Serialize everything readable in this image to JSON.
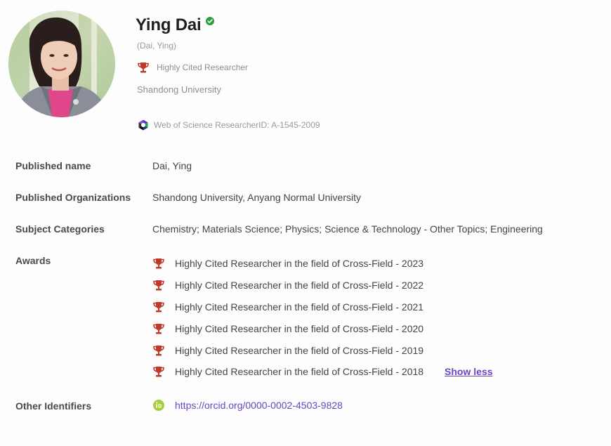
{
  "profile": {
    "name": "Ying Dai",
    "alt_name": "(Dai, Ying)",
    "highly_cited_label": "Highly Cited Researcher",
    "affiliation": "Shandong University",
    "researcher_id": "Web of Science ResearcherID: A-1545-2009"
  },
  "details": {
    "published_name": {
      "label": "Published name",
      "value": "Dai, Ying"
    },
    "published_orgs": {
      "label": "Published Organizations",
      "value": "Shandong University,  Anyang Normal University"
    },
    "subject_categories": {
      "label": "Subject Categories",
      "value": "Chemistry;  Materials Science;  Physics;  Science & Technology - Other Topics;  Engineering"
    },
    "awards": {
      "label": "Awards",
      "items": [
        "Highly Cited Researcher in the field of Cross-Field - 2023",
        "Highly Cited Researcher in the field of Cross-Field - 2022",
        "Highly Cited Researcher in the field of Cross-Field - 2021",
        "Highly Cited Researcher in the field of Cross-Field - 2020",
        "Highly Cited Researcher in the field of Cross-Field - 2019",
        "Highly Cited Researcher in the field of Cross-Field - 2018"
      ],
      "show_less": "Show less"
    },
    "other_identifiers": {
      "label": "Other Identifiers",
      "orcid": "https://orcid.org/0000-0002-4503-9828"
    }
  },
  "icons": {
    "verified": "verified-check-icon",
    "trophy": "trophy-icon",
    "wos": "web-of-science-icon",
    "orcid": "orcid-icon"
  },
  "colors": {
    "trophy": "#c0392b",
    "verified": "#2e9e3e",
    "link": "#6a46c6",
    "orcid": "#a6ce39"
  }
}
